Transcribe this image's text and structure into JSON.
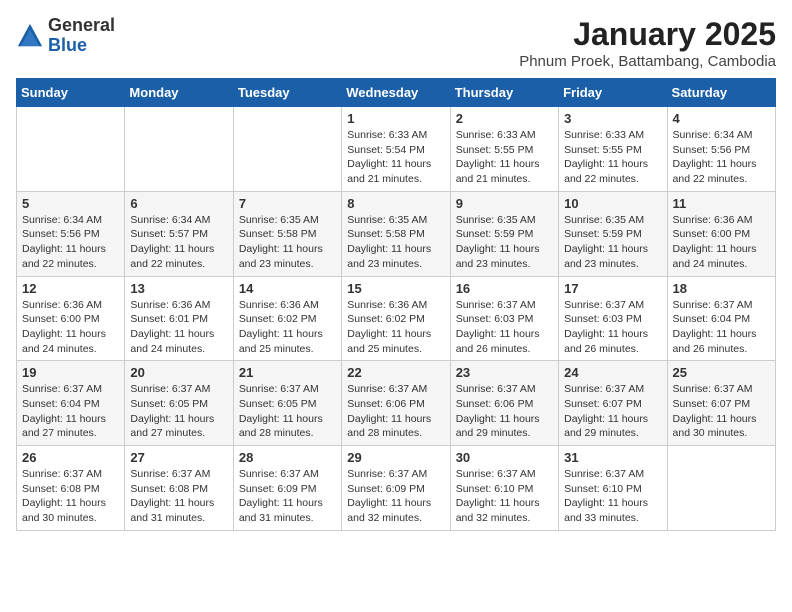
{
  "header": {
    "logo_general": "General",
    "logo_blue": "Blue",
    "title": "January 2025",
    "subtitle": "Phnum Proek, Battambang, Cambodia"
  },
  "weekdays": [
    "Sunday",
    "Monday",
    "Tuesday",
    "Wednesday",
    "Thursday",
    "Friday",
    "Saturday"
  ],
  "weeks": [
    [
      {
        "day": "",
        "info": ""
      },
      {
        "day": "",
        "info": ""
      },
      {
        "day": "",
        "info": ""
      },
      {
        "day": "1",
        "info": "Sunrise: 6:33 AM\nSunset: 5:54 PM\nDaylight: 11 hours\nand 21 minutes."
      },
      {
        "day": "2",
        "info": "Sunrise: 6:33 AM\nSunset: 5:55 PM\nDaylight: 11 hours\nand 21 minutes."
      },
      {
        "day": "3",
        "info": "Sunrise: 6:33 AM\nSunset: 5:55 PM\nDaylight: 11 hours\nand 22 minutes."
      },
      {
        "day": "4",
        "info": "Sunrise: 6:34 AM\nSunset: 5:56 PM\nDaylight: 11 hours\nand 22 minutes."
      }
    ],
    [
      {
        "day": "5",
        "info": "Sunrise: 6:34 AM\nSunset: 5:56 PM\nDaylight: 11 hours\nand 22 minutes."
      },
      {
        "day": "6",
        "info": "Sunrise: 6:34 AM\nSunset: 5:57 PM\nDaylight: 11 hours\nand 22 minutes."
      },
      {
        "day": "7",
        "info": "Sunrise: 6:35 AM\nSunset: 5:58 PM\nDaylight: 11 hours\nand 23 minutes."
      },
      {
        "day": "8",
        "info": "Sunrise: 6:35 AM\nSunset: 5:58 PM\nDaylight: 11 hours\nand 23 minutes."
      },
      {
        "day": "9",
        "info": "Sunrise: 6:35 AM\nSunset: 5:59 PM\nDaylight: 11 hours\nand 23 minutes."
      },
      {
        "day": "10",
        "info": "Sunrise: 6:35 AM\nSunset: 5:59 PM\nDaylight: 11 hours\nand 23 minutes."
      },
      {
        "day": "11",
        "info": "Sunrise: 6:36 AM\nSunset: 6:00 PM\nDaylight: 11 hours\nand 24 minutes."
      }
    ],
    [
      {
        "day": "12",
        "info": "Sunrise: 6:36 AM\nSunset: 6:00 PM\nDaylight: 11 hours\nand 24 minutes."
      },
      {
        "day": "13",
        "info": "Sunrise: 6:36 AM\nSunset: 6:01 PM\nDaylight: 11 hours\nand 24 minutes."
      },
      {
        "day": "14",
        "info": "Sunrise: 6:36 AM\nSunset: 6:02 PM\nDaylight: 11 hours\nand 25 minutes."
      },
      {
        "day": "15",
        "info": "Sunrise: 6:36 AM\nSunset: 6:02 PM\nDaylight: 11 hours\nand 25 minutes."
      },
      {
        "day": "16",
        "info": "Sunrise: 6:37 AM\nSunset: 6:03 PM\nDaylight: 11 hours\nand 26 minutes."
      },
      {
        "day": "17",
        "info": "Sunrise: 6:37 AM\nSunset: 6:03 PM\nDaylight: 11 hours\nand 26 minutes."
      },
      {
        "day": "18",
        "info": "Sunrise: 6:37 AM\nSunset: 6:04 PM\nDaylight: 11 hours\nand 26 minutes."
      }
    ],
    [
      {
        "day": "19",
        "info": "Sunrise: 6:37 AM\nSunset: 6:04 PM\nDaylight: 11 hours\nand 27 minutes."
      },
      {
        "day": "20",
        "info": "Sunrise: 6:37 AM\nSunset: 6:05 PM\nDaylight: 11 hours\nand 27 minutes."
      },
      {
        "day": "21",
        "info": "Sunrise: 6:37 AM\nSunset: 6:05 PM\nDaylight: 11 hours\nand 28 minutes."
      },
      {
        "day": "22",
        "info": "Sunrise: 6:37 AM\nSunset: 6:06 PM\nDaylight: 11 hours\nand 28 minutes."
      },
      {
        "day": "23",
        "info": "Sunrise: 6:37 AM\nSunset: 6:06 PM\nDaylight: 11 hours\nand 29 minutes."
      },
      {
        "day": "24",
        "info": "Sunrise: 6:37 AM\nSunset: 6:07 PM\nDaylight: 11 hours\nand 29 minutes."
      },
      {
        "day": "25",
        "info": "Sunrise: 6:37 AM\nSunset: 6:07 PM\nDaylight: 11 hours\nand 30 minutes."
      }
    ],
    [
      {
        "day": "26",
        "info": "Sunrise: 6:37 AM\nSunset: 6:08 PM\nDaylight: 11 hours\nand 30 minutes."
      },
      {
        "day": "27",
        "info": "Sunrise: 6:37 AM\nSunset: 6:08 PM\nDaylight: 11 hours\nand 31 minutes."
      },
      {
        "day": "28",
        "info": "Sunrise: 6:37 AM\nSunset: 6:09 PM\nDaylight: 11 hours\nand 31 minutes."
      },
      {
        "day": "29",
        "info": "Sunrise: 6:37 AM\nSunset: 6:09 PM\nDaylight: 11 hours\nand 32 minutes."
      },
      {
        "day": "30",
        "info": "Sunrise: 6:37 AM\nSunset: 6:10 PM\nDaylight: 11 hours\nand 32 minutes."
      },
      {
        "day": "31",
        "info": "Sunrise: 6:37 AM\nSunset: 6:10 PM\nDaylight: 11 hours\nand 33 minutes."
      },
      {
        "day": "",
        "info": ""
      }
    ]
  ]
}
